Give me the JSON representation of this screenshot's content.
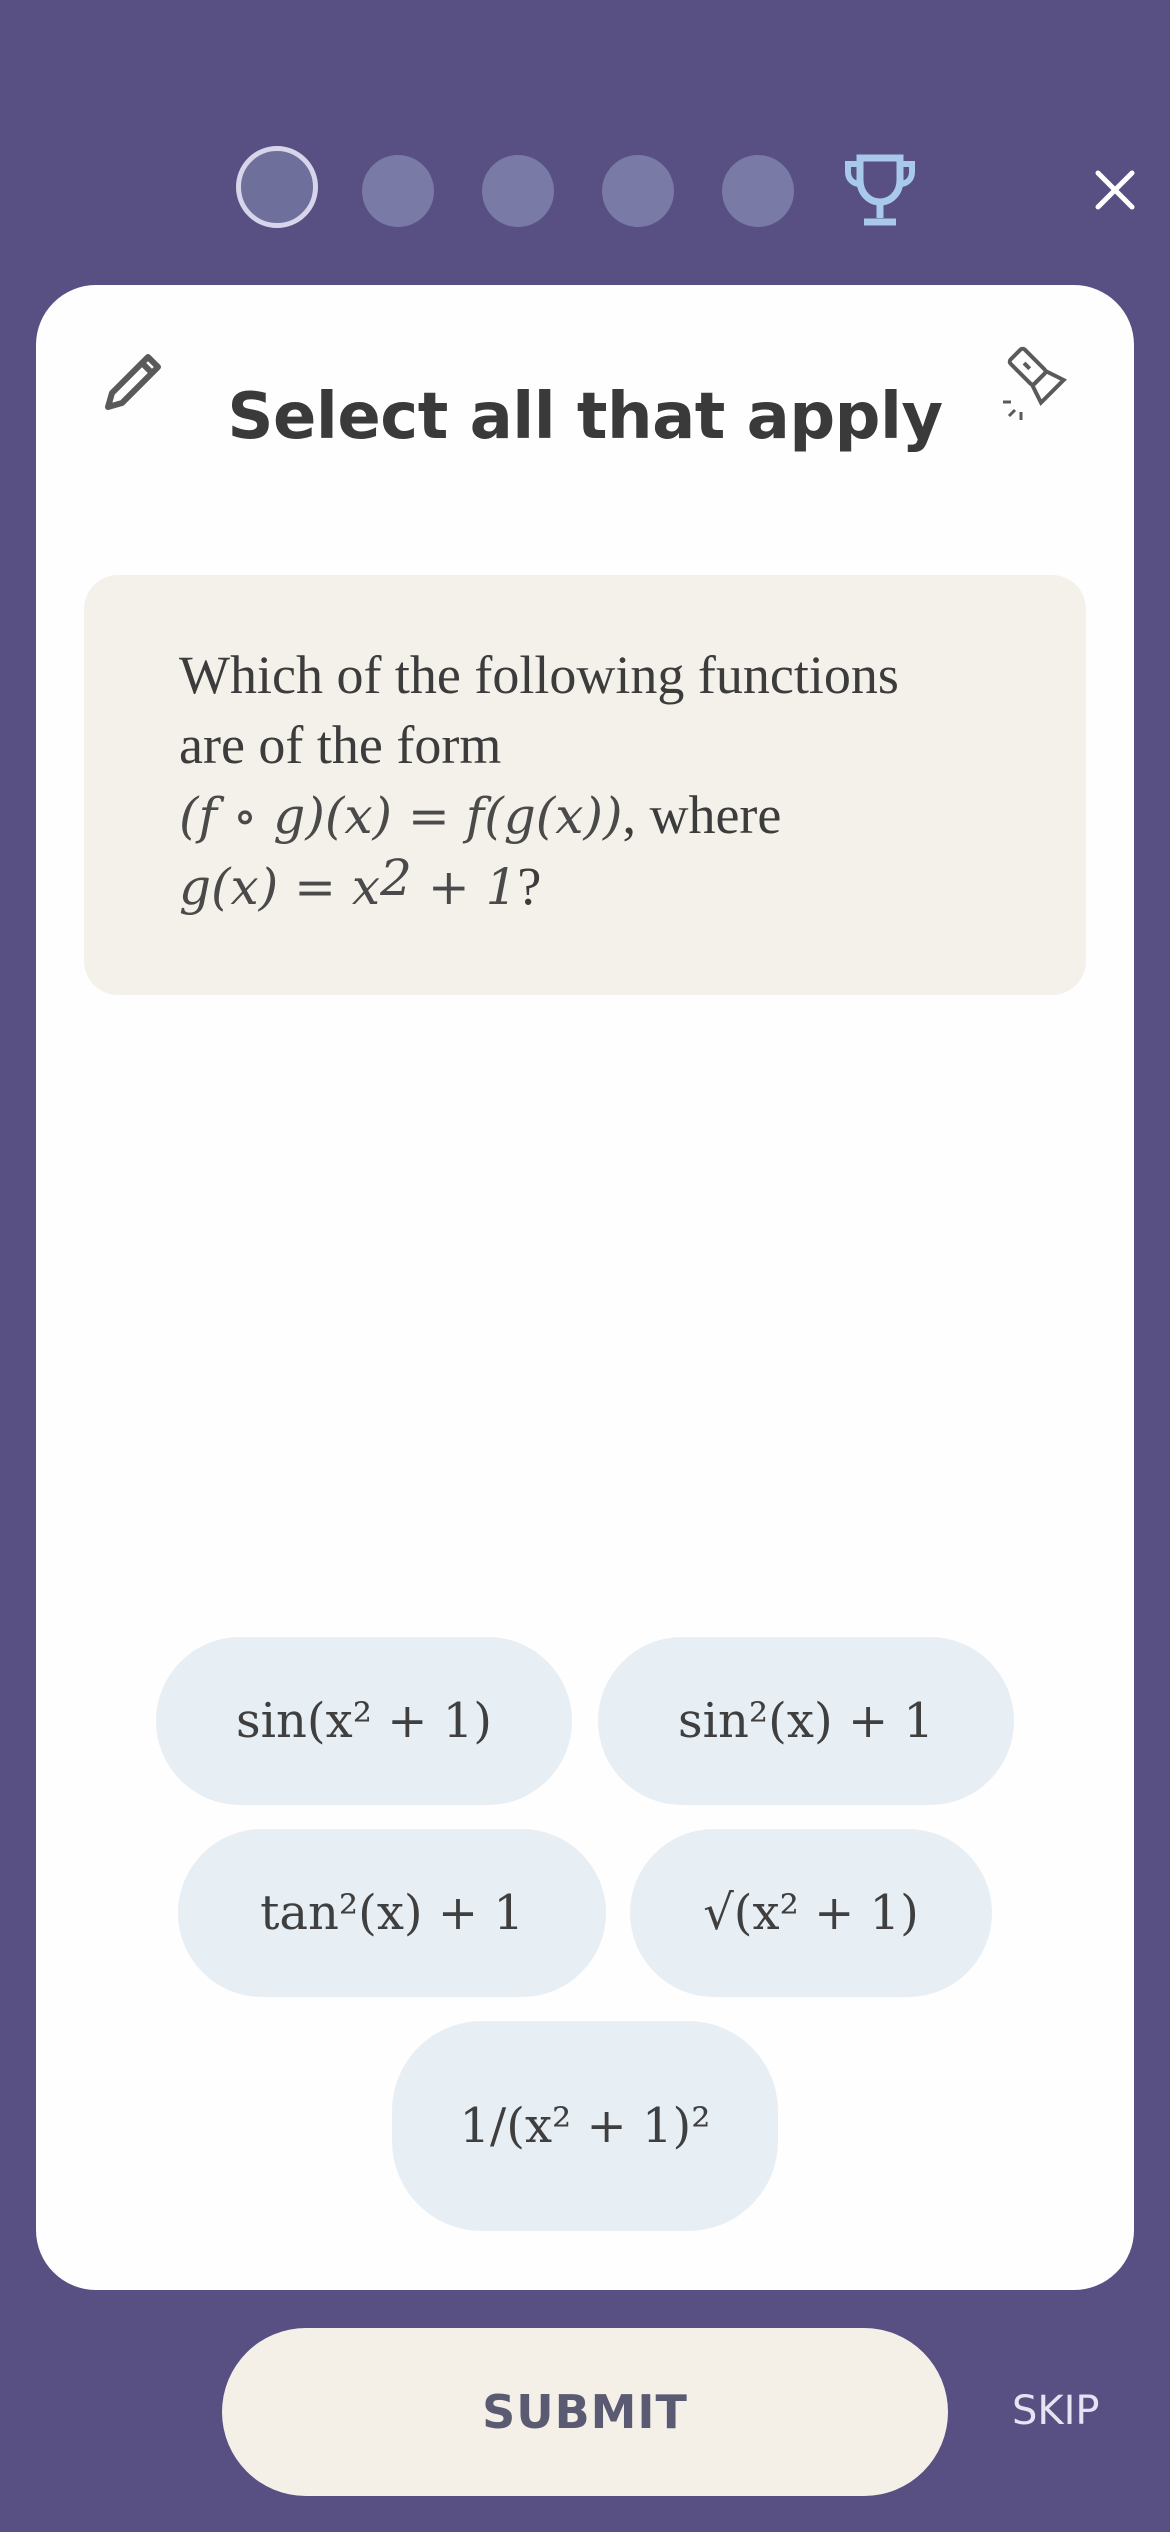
{
  "progress": {
    "steps": 5,
    "current": 1,
    "icons": {
      "goal": "trophy-icon",
      "close": "close-icon"
    },
    "colors": {
      "trophy": "#a9c9ea"
    }
  },
  "card": {
    "title": "Select all that apply",
    "icons": {
      "left": "pencil-icon",
      "right": "flashlight-icon"
    },
    "question": {
      "line1": "Which of the following functions",
      "line2": "are of the form",
      "formula": "(f ∘ g)(x) = f(g(x))",
      "where": ", where",
      "g_def": "g(x) = x",
      "g_exp": "2",
      "g_tail": " + 1",
      "qmark": "?"
    },
    "options": [
      {
        "id": "opt1",
        "label": "sin(x² + 1)"
      },
      {
        "id": "opt2",
        "label": "sin²(x) + 1"
      },
      {
        "id": "opt3",
        "label": "tan²(x) + 1"
      },
      {
        "id": "opt4",
        "label": "√(x² + 1)"
      },
      {
        "id": "opt5",
        "label": "1/(x² + 1)²"
      }
    ]
  },
  "footer": {
    "submit_label": "SUBMIT",
    "skip_label": "SKIP"
  },
  "colors": {
    "background": "#585083",
    "card": "#fefefe",
    "question_bg": "#f4f1ea",
    "option_bg": "#e7eef4",
    "submit_bg": "#f4f0e8"
  }
}
